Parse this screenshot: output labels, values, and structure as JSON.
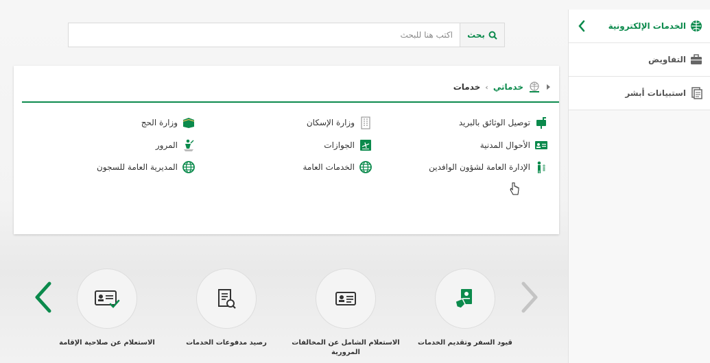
{
  "sidebar": {
    "items": [
      {
        "label": "الخدمات الإلكترونية",
        "icon": "eservices-icon",
        "active": true
      },
      {
        "label": "التفاويض",
        "icon": "briefcase-icon"
      },
      {
        "label": "استبيانات أبشر",
        "icon": "survey-icon"
      }
    ]
  },
  "search": {
    "button_label": "بحث",
    "placeholder": "اكتب هنا للبحث"
  },
  "breadcrumb": {
    "item1": "خدماتي",
    "item2": "خدمات",
    "separator": "›"
  },
  "services": {
    "col1": [
      {
        "label": "توصيل الوثائق بالبريد",
        "icon": "mailbox-icon"
      },
      {
        "label": "الأحوال المدنية",
        "icon": "id-card-icon"
      },
      {
        "label": "الإدارة العامة لشؤون الوافدين",
        "icon": "expat-icon"
      }
    ],
    "col2": [
      {
        "label": "وزارة الإسكان",
        "icon": "building-icon"
      },
      {
        "label": "الجوازات",
        "icon": "passport-icon"
      },
      {
        "label": "الخدمات العامة",
        "icon": "globe-icon"
      }
    ],
    "col3": [
      {
        "label": "وزارة الحج",
        "icon": "kaaba-icon"
      },
      {
        "label": "المرور",
        "icon": "traffic-icon"
      },
      {
        "label": "المديرية العامة للسجون",
        "icon": "globe-icon"
      }
    ]
  },
  "carousel": {
    "items": [
      {
        "label": "قيود السفر وتقديم الخدمات",
        "icon": "travel-doc-icon"
      },
      {
        "label": "الاستعلام الشامل عن المخالفات المرورية",
        "icon": "id-card-icon"
      },
      {
        "label": "رصيد مدفوعات الخدمات",
        "icon": "receipt-icon"
      },
      {
        "label": "الاستعلام عن صلاحية الإقامة",
        "icon": "id-check-icon"
      }
    ]
  },
  "colors": {
    "accent": "#0b8a4c",
    "text": "#333333",
    "muted": "#8a8a8a"
  }
}
